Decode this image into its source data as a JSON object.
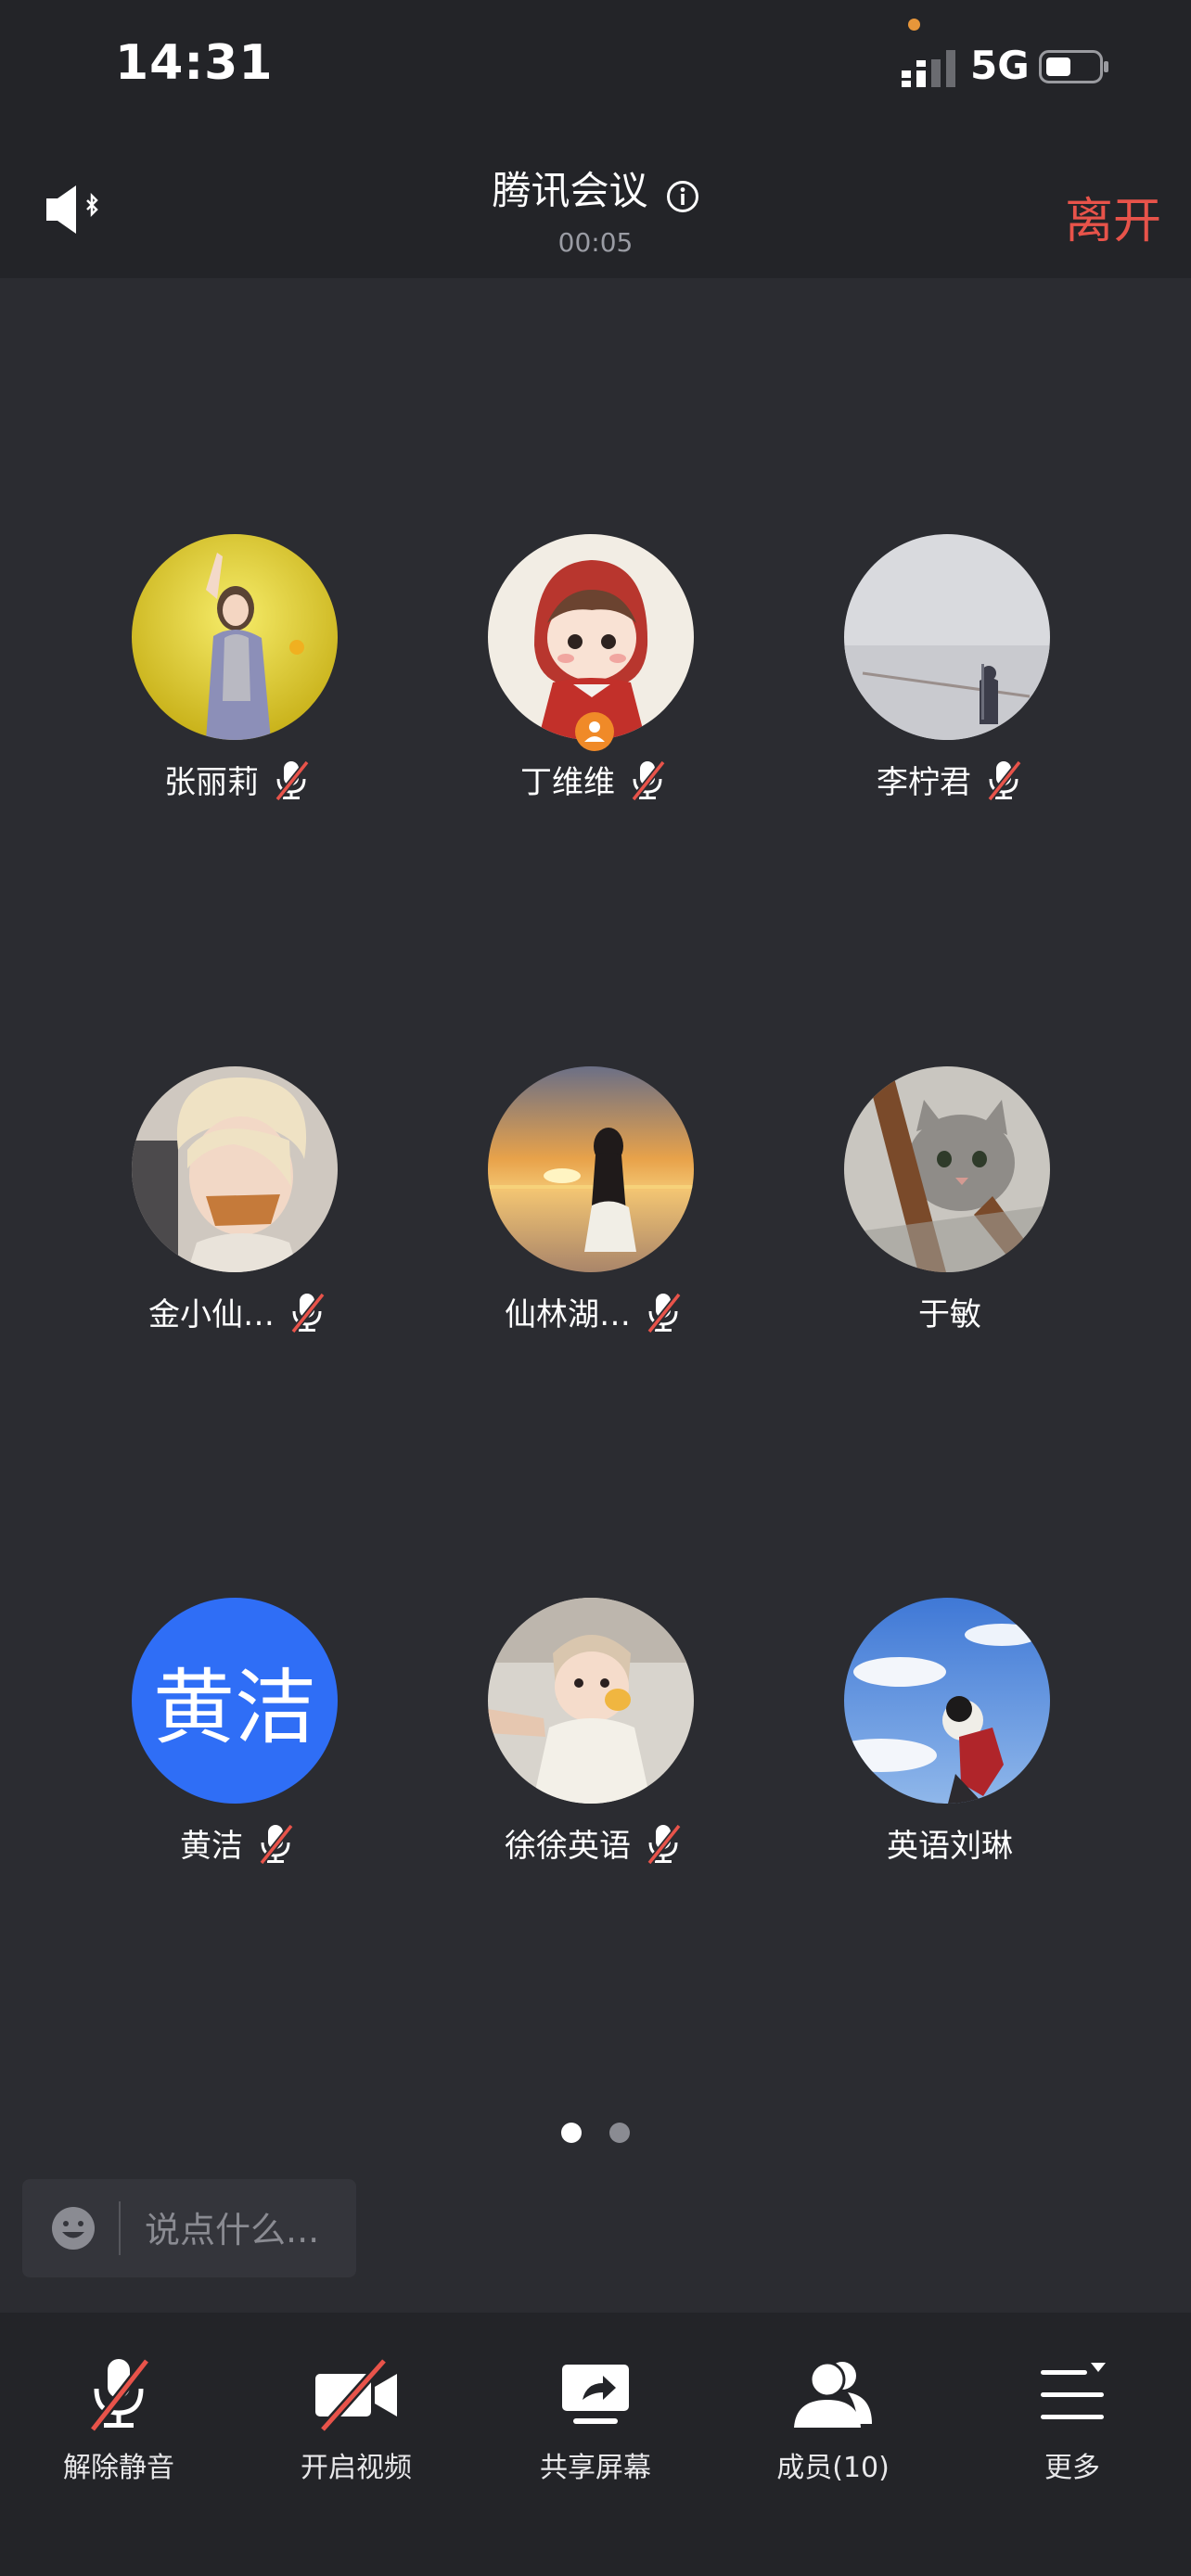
{
  "status_bar": {
    "time": "14:31",
    "network": "5G"
  },
  "header": {
    "title": "腾讯会议",
    "duration": "00:05",
    "leave_label": "离开"
  },
  "participants": [
    {
      "name": "张丽莉",
      "muted": true
    },
    {
      "name": "丁维维",
      "muted": true,
      "host": true
    },
    {
      "name": "李柠君",
      "muted": true
    },
    {
      "name": "金小仙…",
      "muted": true
    },
    {
      "name": "仙林湖…",
      "muted": true
    },
    {
      "name": "于敏",
      "muted": false
    },
    {
      "name": "黄洁",
      "muted": true,
      "avatar_text": "黄洁",
      "avatar_color": "#2f6ef6"
    },
    {
      "name": "徐徐英语",
      "muted": true
    },
    {
      "name": "英语刘琳",
      "muted": false
    }
  ],
  "pagination": {
    "pages": 2,
    "current": 1
  },
  "chat": {
    "placeholder": "说点什么..."
  },
  "toolbar": {
    "unmute_label": "解除静音",
    "video_label": "开启视频",
    "share_label": "共享屏幕",
    "members_label": "成员(10)",
    "more_label": "更多"
  },
  "colors": {
    "leave": "#e8534a",
    "accent": "#2f6ef6",
    "host_badge": "#f08a28",
    "muted_slash": "#e8534a"
  }
}
